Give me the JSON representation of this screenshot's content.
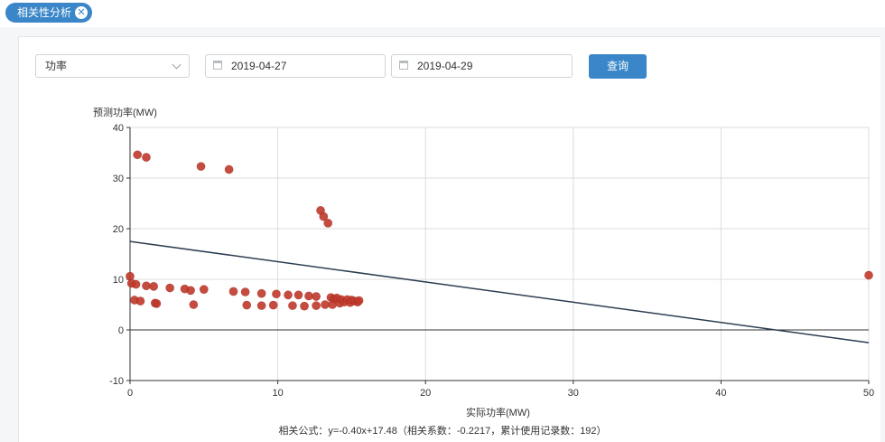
{
  "tab": {
    "label": "相关性分析",
    "close_glyph": "✕"
  },
  "filters": {
    "metric": "功率",
    "start_date": "2019-04-27",
    "end_date": "2019-04-29",
    "query_label": "查询"
  },
  "colors": {
    "accent": "#3a86c8",
    "point": "#c0392b",
    "line": "#2c3e50"
  },
  "chart_data": {
    "type": "scatter",
    "xlabel": "实际功率(MW)",
    "ylabel": "预测功率(MW)",
    "xlim": [
      0,
      50
    ],
    "ylim": [
      -10,
      40
    ],
    "xticks": [
      0,
      10,
      20,
      30,
      40,
      50
    ],
    "yticks": [
      -10,
      0,
      10,
      20,
      30,
      40
    ],
    "grid": true,
    "points": [
      [
        0.0,
        10.6
      ],
      [
        0.1,
        9.2
      ],
      [
        0.4,
        9.0
      ],
      [
        0.3,
        5.9
      ],
      [
        0.7,
        5.7
      ],
      [
        0.5,
        34.6
      ],
      [
        1.1,
        8.7
      ],
      [
        1.1,
        34.1
      ],
      [
        1.6,
        8.6
      ],
      [
        1.7,
        5.3
      ],
      [
        1.8,
        5.2
      ],
      [
        2.7,
        8.3
      ],
      [
        3.7,
        8.1
      ],
      [
        4.1,
        7.8
      ],
      [
        4.3,
        5.0
      ],
      [
        4.8,
        32.3
      ],
      [
        5.0,
        8.0
      ],
      [
        6.7,
        31.7
      ],
      [
        7.0,
        7.6
      ],
      [
        7.8,
        7.5
      ],
      [
        7.9,
        4.9
      ],
      [
        8.9,
        7.2
      ],
      [
        8.9,
        4.8
      ],
      [
        9.7,
        4.9
      ],
      [
        9.9,
        7.1
      ],
      [
        10.7,
        6.9
      ],
      [
        11.0,
        4.8
      ],
      [
        11.4,
        6.9
      ],
      [
        11.8,
        4.7
      ],
      [
        12.1,
        6.7
      ],
      [
        12.6,
        6.6
      ],
      [
        12.6,
        4.8
      ],
      [
        12.9,
        23.6
      ],
      [
        13.1,
        22.4
      ],
      [
        13.2,
        5.0
      ],
      [
        13.4,
        21.1
      ],
      [
        13.6,
        6.4
      ],
      [
        13.8,
        6.1
      ],
      [
        13.7,
        5.0
      ],
      [
        14.0,
        6.3
      ],
      [
        14.2,
        5.3
      ],
      [
        14.3,
        6.0
      ],
      [
        14.5,
        5.5
      ],
      [
        14.7,
        6.0
      ],
      [
        14.9,
        5.4
      ],
      [
        15.0,
        5.9
      ],
      [
        15.2,
        5.7
      ],
      [
        15.4,
        5.5
      ],
      [
        15.5,
        5.8
      ],
      [
        50.0,
        10.8
      ]
    ],
    "fit_line": {
      "slope": -0.4,
      "intercept": 17.48
    },
    "annotation": "相关公式：y=-0.40x+17.48（相关系数：-0.2217，累计使用记录数：192）"
  }
}
